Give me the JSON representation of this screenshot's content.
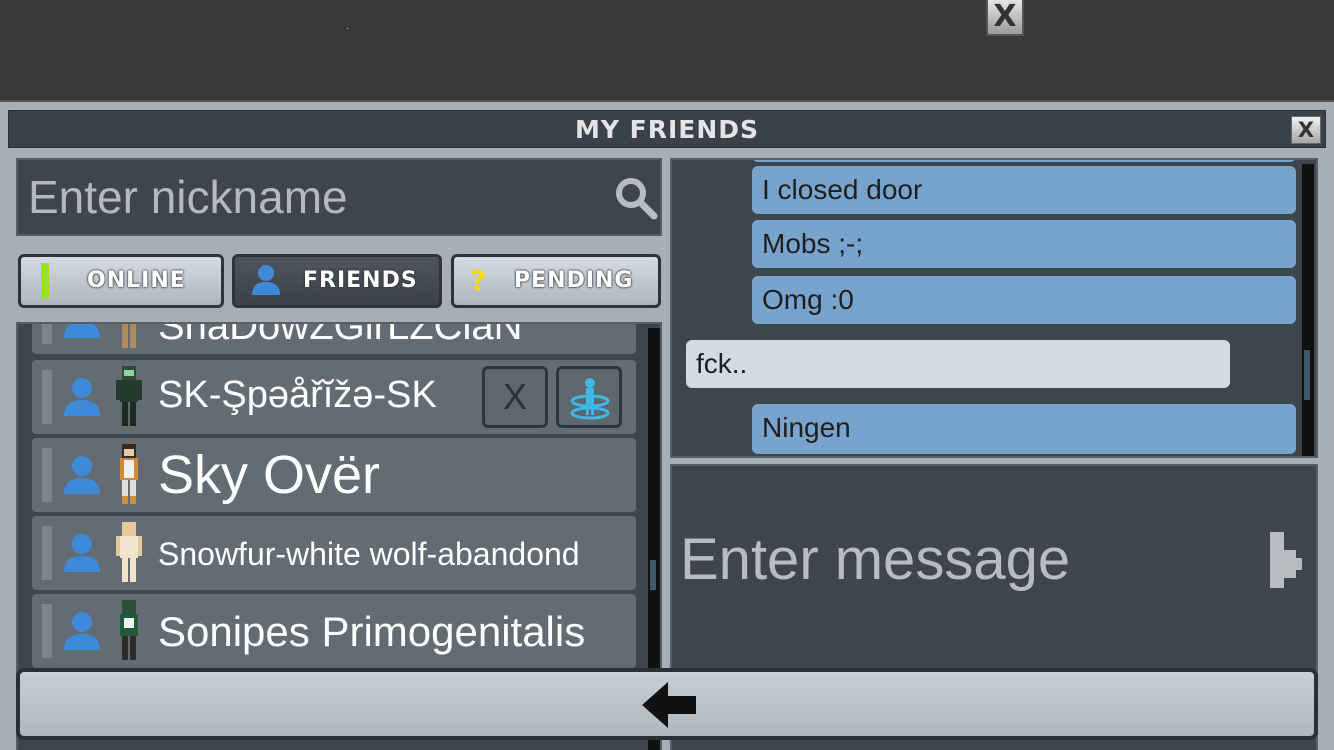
{
  "top": {
    "close_label": "X"
  },
  "window": {
    "title": "MY FRIENDS",
    "close_label": "X"
  },
  "search": {
    "placeholder": "Enter nickname"
  },
  "tabs": [
    {
      "label": "ONLINE",
      "active": false
    },
    {
      "label": "FRIENDS",
      "active": true
    },
    {
      "label": "PENDING",
      "active": false
    }
  ],
  "friends": [
    {
      "name": "ShaDowZGirLZClaN",
      "partial": true
    },
    {
      "name": "SK-Şpəåřĭžə-SK",
      "selected": true,
      "remove_label": "X"
    },
    {
      "name": "Sky Ovër"
    },
    {
      "name": "Snowfur-white wolf-abandond"
    },
    {
      "name": "Sonipes Primogenitalis"
    }
  ],
  "chat": {
    "messages": [
      {
        "text": "I closed door",
        "own": true
      },
      {
        "text": "Mobs ;-;",
        "own": true
      },
      {
        "text": "Omg :0",
        "own": true
      },
      {
        "text": "fck..",
        "own": false
      },
      {
        "text": "Ningen",
        "own": true
      }
    ],
    "input_placeholder": "Enter message"
  },
  "colors": {
    "online_indicator": "#9be025",
    "own_message": "#78a3cc",
    "other_message": "#d2dce4",
    "person_icon": "#3f8ad8"
  },
  "icons": {
    "search": "search-icon",
    "person": "person-icon",
    "question": "question-icon",
    "teleport": "teleport-icon",
    "send": "send-icon",
    "back": "back-arrow-icon"
  }
}
